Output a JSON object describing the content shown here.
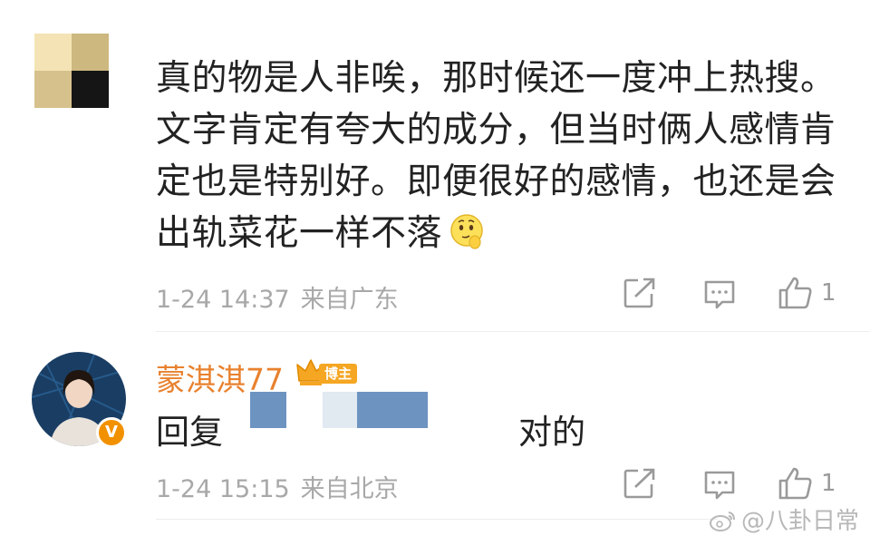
{
  "comment1": {
    "text": "真的物是人非唉，那时候还一度冲上热搜。文字肯定有夸大的成分，但当时俩人感情肯定也是特别好。即便很好的感情，也还是会出轨菜花一样不落",
    "emoji": "thinking-emoji",
    "time": "1-24 14:37",
    "location": "来自广东",
    "like_count": "1"
  },
  "comment2": {
    "username": "蒙淇淇77",
    "badge_label": "博主",
    "verified_badge": "V",
    "reply_prefix": "回复",
    "reply_text": "对的",
    "time": "1-24 15:15",
    "location": "来自北京",
    "like_count": "1"
  },
  "watermark": "@八卦日常",
  "colors": {
    "username": "#e8812e",
    "verified": "#f29100",
    "meta": "#a8a8a8",
    "text": "#222222"
  },
  "icons": [
    "share-icon",
    "comment-icon",
    "like-icon",
    "crown-icon",
    "weibo-icon"
  ]
}
